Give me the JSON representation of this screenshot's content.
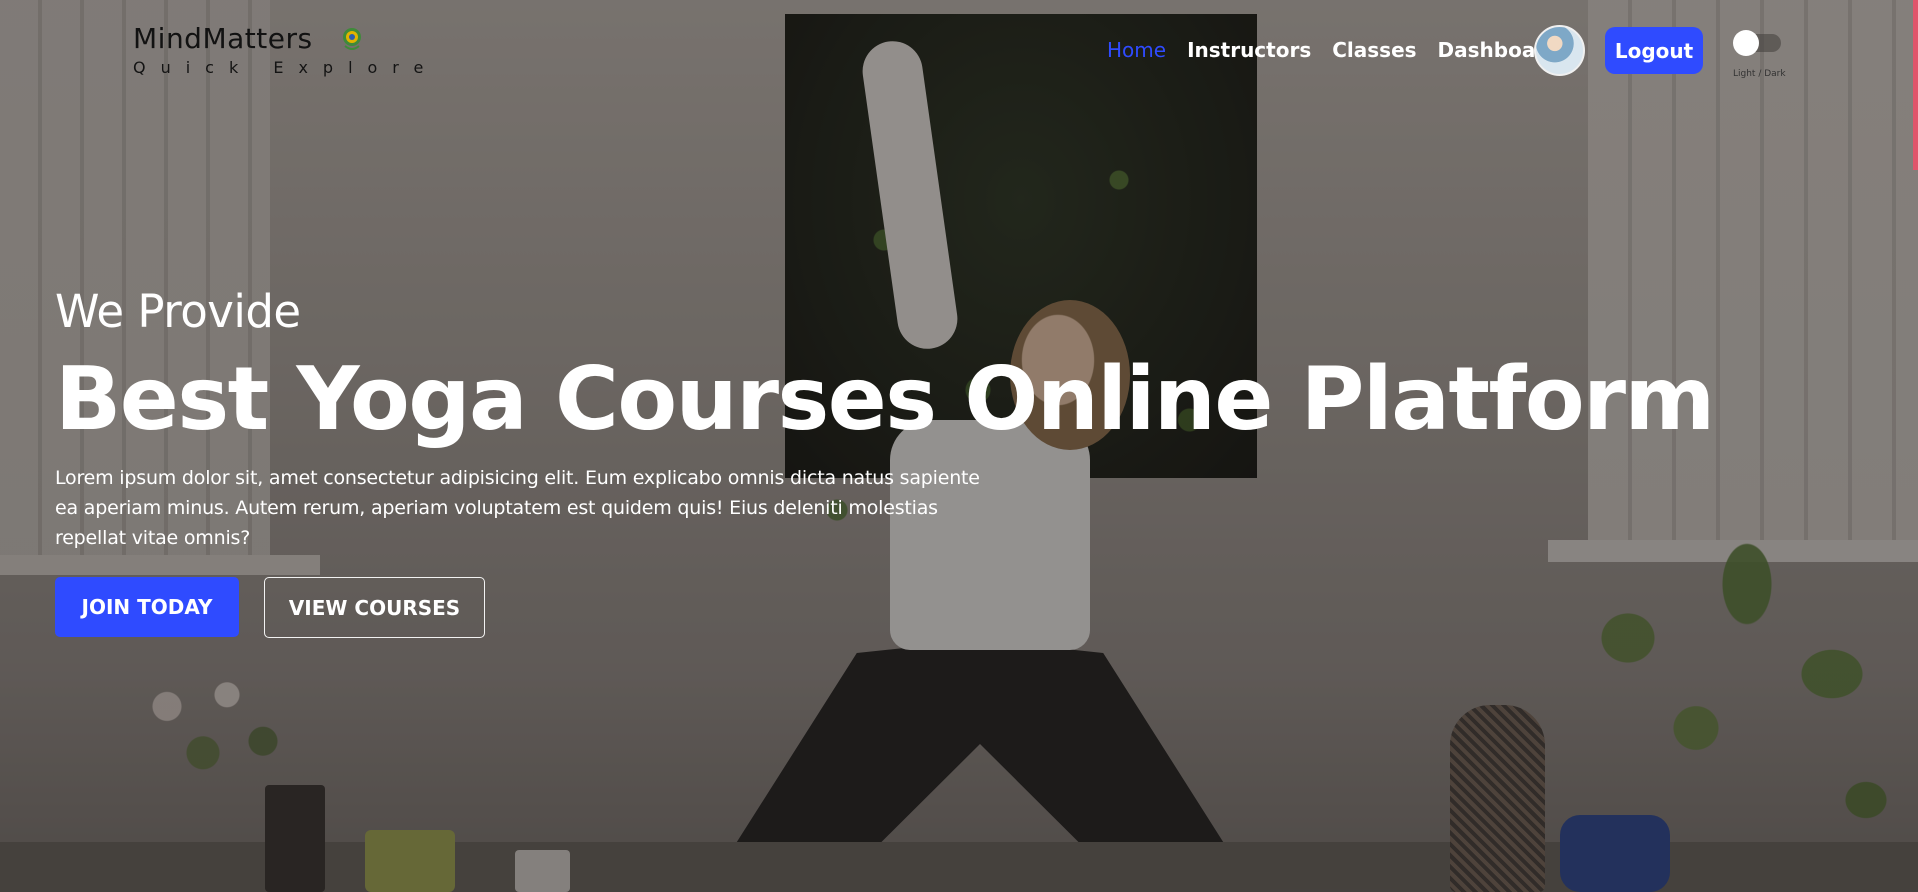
{
  "brand": {
    "name": "MindMatters",
    "tagline": "Quick Explore"
  },
  "nav": {
    "links": [
      {
        "label": "Home",
        "active": true
      },
      {
        "label": "Instructors",
        "active": false
      },
      {
        "label": "Classes",
        "active": false
      },
      {
        "label": "Dashboard",
        "active": false
      }
    ],
    "logout_label": "Logout",
    "theme_toggle_label": "Light / Dark"
  },
  "hero": {
    "pre_title": "We Provide",
    "title": "Best Yoga Courses Online Platform",
    "description": "Lorem ipsum dolor sit, amet consectetur adipisicing elit. Eum explicabo omnis dicta natus sapiente ea aperiam minus. Autem rerum, aperiam voluptatem est quidem quis! Eius deleniti molestias repellat vitae omnis?",
    "primary_button": "JOIN TODAY",
    "secondary_button": "VIEW COURSES"
  },
  "colors": {
    "accent": "#2f4bff",
    "text_light": "#ffffff",
    "brand_text": "#121212"
  },
  "icons": {
    "logo": "lotus-logo-icon",
    "avatar": "user-avatar"
  }
}
